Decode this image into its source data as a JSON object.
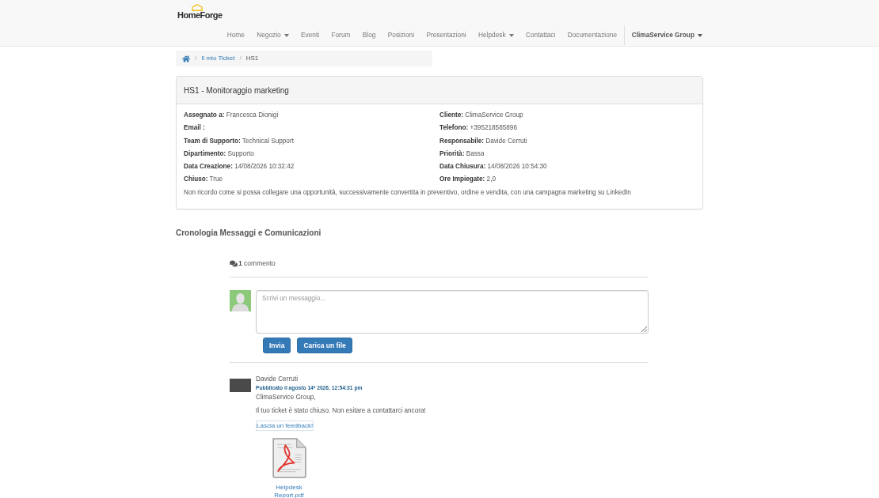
{
  "navbar": {
    "logo": "HomeForge",
    "items": [
      {
        "label": "Home",
        "dropdown": false
      },
      {
        "label": "Negozio",
        "dropdown": true
      },
      {
        "label": "Eventi",
        "dropdown": false
      },
      {
        "label": "Forum",
        "dropdown": false
      },
      {
        "label": "Blog",
        "dropdown": false
      },
      {
        "label": "Posizioni",
        "dropdown": false
      },
      {
        "label": "Presentazioni",
        "dropdown": false
      },
      {
        "label": "Helpdesk",
        "dropdown": true
      },
      {
        "label": "Contattaci",
        "dropdown": false
      },
      {
        "label": "Documentazione",
        "dropdown": false
      }
    ],
    "account": {
      "label": "ClimaService Group",
      "dropdown": true
    }
  },
  "breadcrumb": {
    "separator": "/",
    "items": [
      {
        "label": "Il mio Ticket",
        "current": false
      },
      {
        "label": "HS1",
        "current": true
      }
    ]
  },
  "ticket": {
    "title": "HS1 - Monitoraggio marketing",
    "fields": [
      {
        "label": "Assegnato a:",
        "value": "Francesca Dionigi"
      },
      {
        "label": "Cliente:",
        "value": "ClimaService Group"
      },
      {
        "label": "Email :"
      },
      {
        "label": "Telefono:",
        "value": "+395218585896"
      },
      {
        "label": "Team di Supporto:",
        "value": "Technical Support"
      },
      {
        "label": "Responsabile:",
        "value": "Davide Cerruti"
      },
      {
        "label": "Dipartimento:",
        "value": "Supporto"
      },
      {
        "label": "Priorità:",
        "value": "Bassa"
      },
      {
        "label": "Data Creazione:",
        "value": "14/08/2026 10:32:42"
      },
      {
        "label": "Data Chiusura:",
        "value": "14/08/2026 10:54:30"
      },
      {
        "label": "Chiuso:",
        "value": "True"
      },
      {
        "label": "Ore Impiegate:",
        "value": "2,0"
      }
    ],
    "description": "Non ricordo come si possa collegare una opportunità, successivamente convertita in preventivo, ordine e vendita, con una campagna marketing su LinkedIn"
  },
  "history": {
    "title": "Cronologia Messaggi e Comunicazioni",
    "count": "**1** commento",
    "composer": {
      "placeholder": "Scrivi un messaggio..."
    },
    "buttons": [
      "Invia",
      "Carica un file"
    ],
    "comments": [
      {
        "author": "Davide Cerruti",
        "posted": "Pubblicato il agosto 14ª 2026, 12:54:31 pm",
        "paragraphs": [
          "ClimaService Group,",
          "Il tuo ticket è stato chiuso. Non esitare a contattarci ancora!"
        ],
        "link": "Lascia un feedback!",
        "attachments": [
          {
            "name": "Helpdesk Report.pdf"
          }
        ]
      }
    ]
  }
}
